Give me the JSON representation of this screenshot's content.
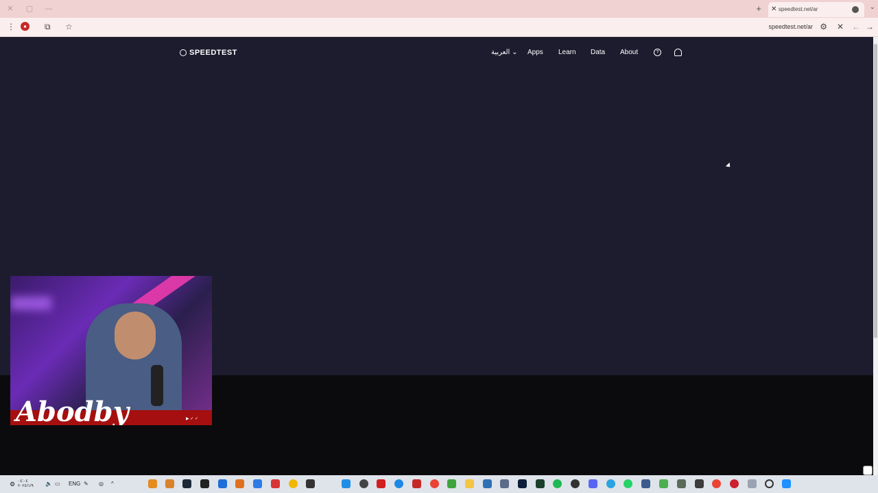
{
  "browser": {
    "tab_title": "speedtest.net/ar",
    "url": "speedtest.net/ar"
  },
  "site": {
    "logo": "SPEEDTEST",
    "nav": {
      "language": "العربية",
      "apps": "Apps",
      "learn": "Learn",
      "data": "Data",
      "about": "About"
    }
  },
  "overlay": {
    "signature": "Abodby"
  },
  "taskbar": {
    "clock": "٠٤:٠٤\n٢٠٢٤/١/٩",
    "lang": "ENG"
  },
  "colors": {
    "page_bg": "#1c1c2e",
    "tab_bar": "#f0d2d2",
    "toolbar": "#fbeeee"
  }
}
